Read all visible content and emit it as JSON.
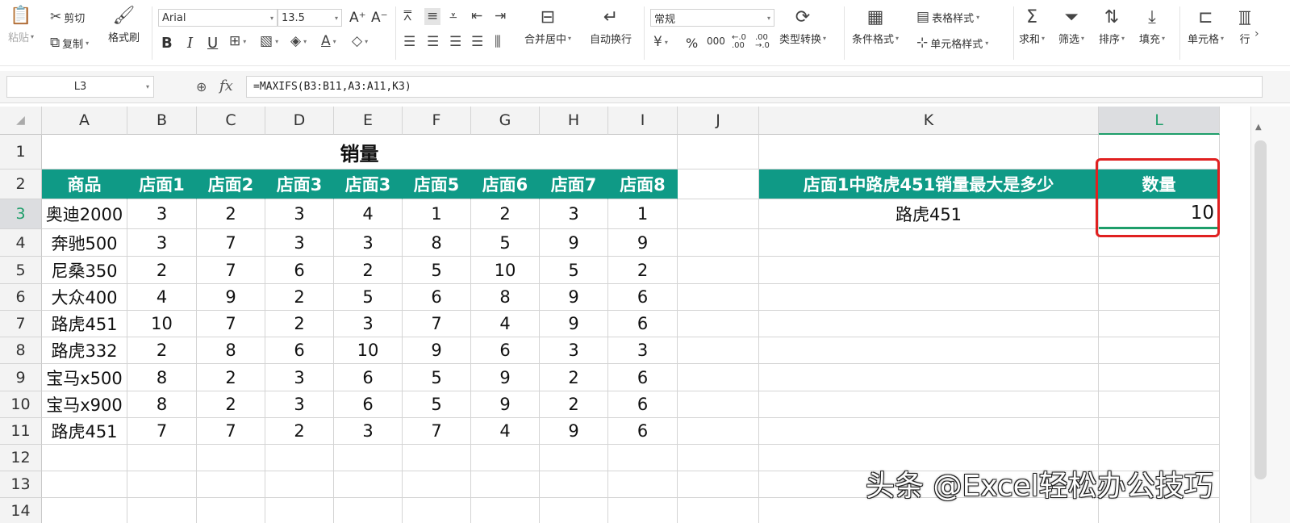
{
  "ribbon": {
    "clipboard": {
      "paste": "粘贴",
      "cut": "剪切",
      "copy": "复制",
      "format_painter": "格式刷"
    },
    "font": {
      "name": "Arial",
      "size": "13.5"
    },
    "alignment": {
      "merge_center": "合并居中",
      "wrap_text": "自动换行"
    },
    "number": {
      "format": "常规",
      "type_convert": "类型转换",
      "percent": "%",
      "thousands": "000",
      "currency": "¥"
    },
    "styles": {
      "conditional": "条件格式",
      "table_style": "表格样式",
      "cell_style": "单元格样式"
    },
    "editing": {
      "sum": "求和",
      "filter": "筛选",
      "sort": "排序",
      "fill": "填充",
      "cell": "单元格",
      "row_col": "行"
    }
  },
  "formula_bar": {
    "name_box": "L3",
    "fx": "fx",
    "formula": "=MAXIFS(B3:B11,A3:A11,K3)"
  },
  "sheet": {
    "columns": [
      "A",
      "B",
      "C",
      "D",
      "E",
      "F",
      "G",
      "H",
      "I",
      "J",
      "K",
      "L"
    ],
    "rows": [
      "1",
      "2",
      "3",
      "4",
      "5",
      "6",
      "7",
      "8",
      "9",
      "10",
      "11",
      "12",
      "13",
      "14"
    ],
    "title": "销量",
    "headers": [
      "商品",
      "店面1",
      "店面2",
      "店面3",
      "店面3",
      "店面5",
      "店面6",
      "店面7",
      "店面8"
    ],
    "data": [
      [
        "奥迪2000",
        "3",
        "2",
        "3",
        "4",
        "1",
        "2",
        "3",
        "1"
      ],
      [
        "奔驰500",
        "3",
        "7",
        "3",
        "3",
        "8",
        "5",
        "9",
        "9"
      ],
      [
        "尼桑350",
        "2",
        "7",
        "6",
        "2",
        "5",
        "10",
        "5",
        "2"
      ],
      [
        "大众400",
        "4",
        "9",
        "2",
        "5",
        "6",
        "8",
        "9",
        "6"
      ],
      [
        "路虎451",
        "10",
        "7",
        "2",
        "3",
        "7",
        "4",
        "9",
        "6"
      ],
      [
        "路虎332",
        "2",
        "8",
        "6",
        "10",
        "9",
        "6",
        "3",
        "3"
      ],
      [
        "宝马x500",
        "8",
        "2",
        "3",
        "6",
        "5",
        "9",
        "2",
        "6"
      ],
      [
        "宝马x900",
        "8",
        "2",
        "3",
        "6",
        "5",
        "9",
        "2",
        "6"
      ],
      [
        "路虎451",
        "7",
        "7",
        "2",
        "3",
        "7",
        "4",
        "9",
        "6"
      ]
    ],
    "question": "店面1中路虎451销量最大是多少",
    "answer_header": "数量",
    "criteria": "路虎451",
    "answer": "10",
    "active_cell": "L3",
    "colors": {
      "header_fill": "#0f9a86",
      "highlight_box": "#e02020",
      "active_header": "#1e9e6a"
    }
  },
  "watermark": "头条 @Excel轻松办公技巧"
}
